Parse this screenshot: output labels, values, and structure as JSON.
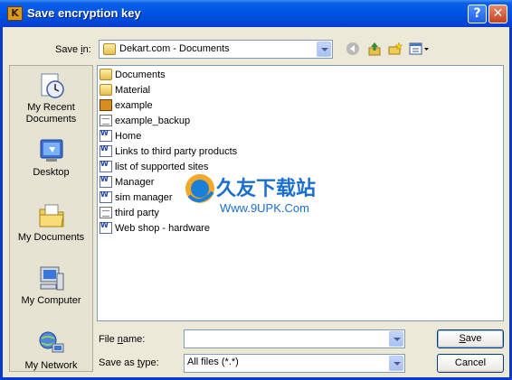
{
  "window": {
    "title": "Save encryption key",
    "help_glyph": "?",
    "close_glyph": "✕"
  },
  "save_in": {
    "label_pre": "Save ",
    "label_key": "i",
    "label_post": "n:",
    "value": "Dekart.com - Documents"
  },
  "toolbar": {
    "icons": [
      "back-icon",
      "up-folder-icon",
      "new-folder-icon",
      "views-menu-icon"
    ]
  },
  "places": [
    {
      "label": "My Recent Documents",
      "icon": "recent-documents-icon"
    },
    {
      "label": "Desktop",
      "icon": "desktop-icon"
    },
    {
      "label": "My Documents",
      "icon": "my-documents-icon"
    },
    {
      "label": "My Computer",
      "icon": "my-computer-icon"
    },
    {
      "label": "My Network",
      "icon": "my-network-icon"
    }
  ],
  "files": [
    {
      "name": "Documents",
      "type": "folder"
    },
    {
      "name": "Material",
      "type": "folder"
    },
    {
      "name": "example",
      "type": "exe"
    },
    {
      "name": "example_backup",
      "type": "txt"
    },
    {
      "name": "Home",
      "type": "doc"
    },
    {
      "name": "Links to third party products",
      "type": "doc"
    },
    {
      "name": "list of supported sites",
      "type": "doc"
    },
    {
      "name": "Manager",
      "type": "doc"
    },
    {
      "name": "sim manager",
      "type": "doc"
    },
    {
      "name": "third party",
      "type": "txt"
    },
    {
      "name": "Web shop - hardware",
      "type": "doc"
    }
  ],
  "file_name": {
    "label_pre": "File ",
    "label_key": "n",
    "label_post": "ame:",
    "value": ""
  },
  "save_as_type": {
    "label_pre": "Save as ",
    "label_key": "t",
    "label_post": "ype:",
    "value": "All files (*.*)"
  },
  "buttons": {
    "save_pre": "",
    "save_key": "S",
    "save_post": "ave",
    "cancel": "Cancel"
  },
  "watermark": {
    "cn": "久友下载站",
    "url": "Www.9UPK.Com"
  }
}
